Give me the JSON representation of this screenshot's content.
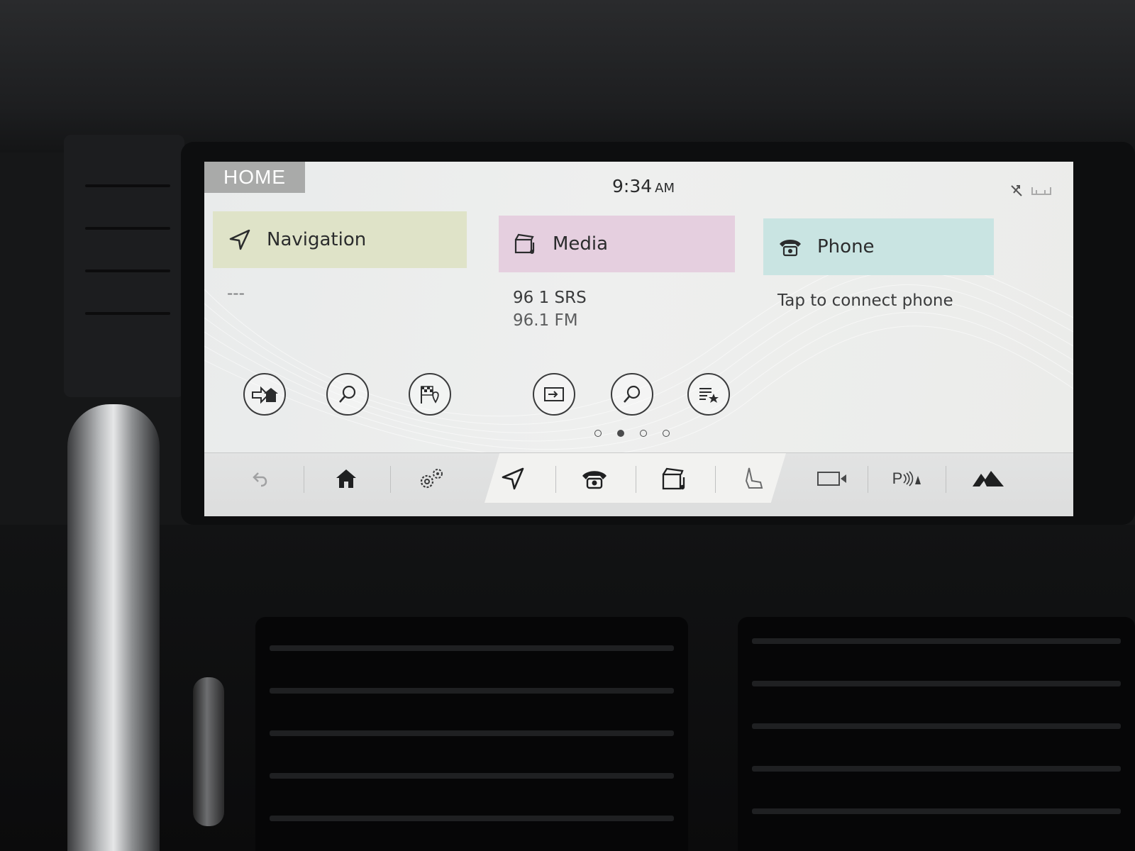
{
  "status": {
    "home_label": "HOME",
    "time": "9:34",
    "ampm": "AM"
  },
  "tiles": {
    "navigation": {
      "title": "Navigation",
      "body": "---",
      "color": "#dfe3c8"
    },
    "media": {
      "title": "Media",
      "line1": "96 1 SRS",
      "line2": "96.1 FM",
      "color": "#e5cfdf"
    },
    "phone": {
      "title": "Phone",
      "body": "Tap to connect phone",
      "color": "#c9e4e2"
    }
  },
  "icons": {
    "navigation_header": "navigation-arrow-icon",
    "media_header": "clapper-music-icon",
    "phone_header": "telephone-icon",
    "nav_actions": [
      "go-home-icon",
      "search-icon",
      "destination-flag-icon"
    ],
    "media_actions": [
      "source-input-icon",
      "search-icon",
      "favorites-list-icon"
    ],
    "bottom_bar": [
      "back-icon",
      "home-icon",
      "settings-gears-icon",
      "navigation-arrow-icon",
      "telephone-icon",
      "clapper-music-icon",
      "seat-icon",
      "camera-icon",
      "parking-sensor-icon",
      "terrain-response-icon"
    ]
  },
  "bottom_bar": {
    "parking_label": "P"
  },
  "page_indicator": {
    "count": 4,
    "active": 1
  }
}
